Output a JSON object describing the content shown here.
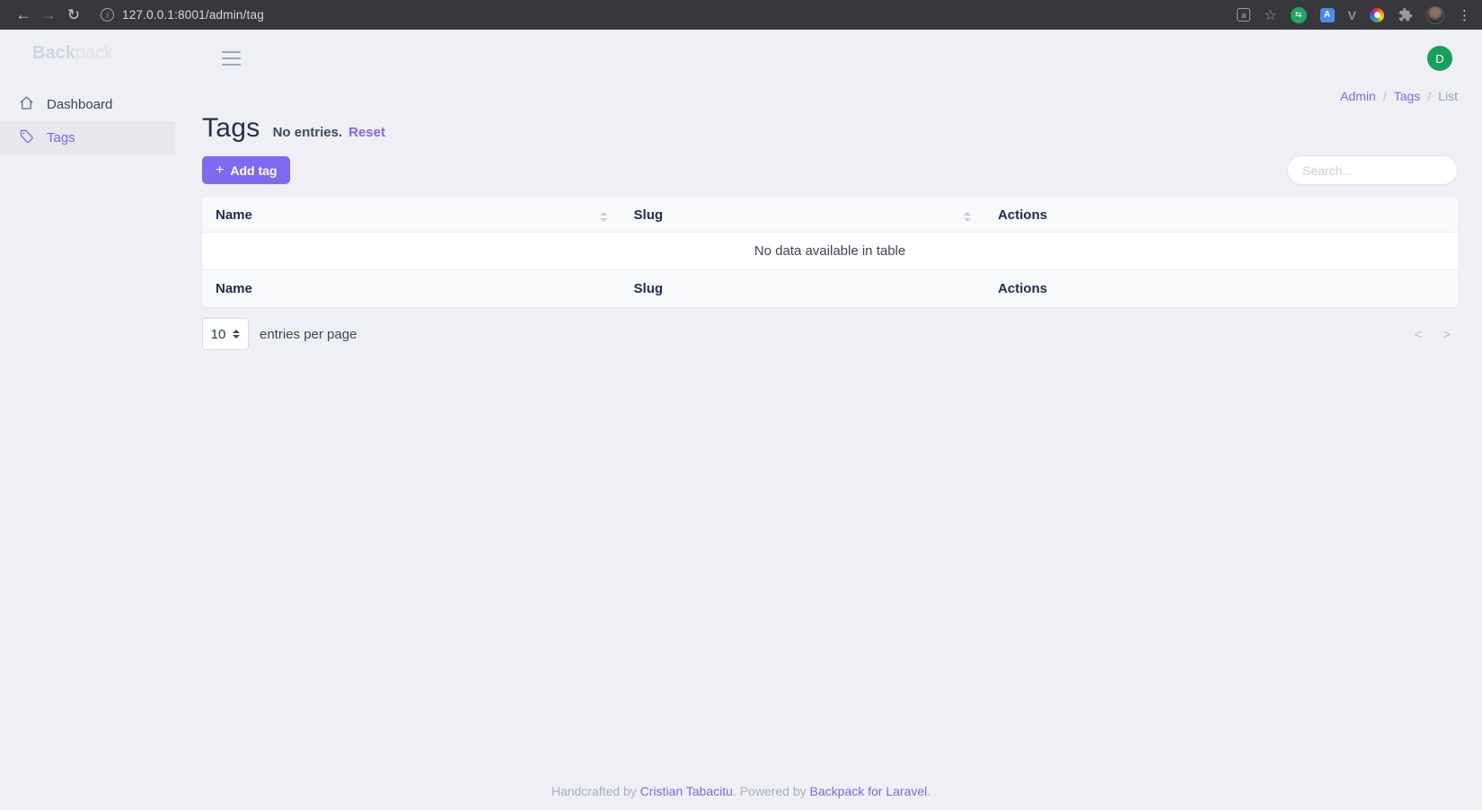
{
  "browser": {
    "url": "127.0.0.1:8001/admin/tag",
    "icons": {
      "back": "←",
      "forward": "→",
      "reload": "↻",
      "info": "i",
      "translate_page_letter": "a",
      "star": "☆",
      "hangouts_glyph": "⇆",
      "translate_ext_letter": "A",
      "vue_letter": "V",
      "menu_dots": "⋮"
    }
  },
  "sidebar": {
    "logo": {
      "bold": "Back",
      "light": "pack"
    },
    "items": [
      {
        "label": "Dashboard"
      },
      {
        "label": "Tags"
      }
    ]
  },
  "topbar": {
    "avatar_letter": "D"
  },
  "breadcrumb": {
    "items": [
      {
        "label": "Admin"
      },
      {
        "label": "Tags"
      },
      {
        "label": "List"
      }
    ],
    "separator": "/"
  },
  "page": {
    "title": "Tags",
    "subtitle": "No entries.",
    "reset_label": "Reset",
    "add_button_icon": "+",
    "add_button_label": "Add tag"
  },
  "search": {
    "placeholder": "Search..."
  },
  "table": {
    "columns": [
      "Name",
      "Slug",
      "Actions"
    ],
    "empty_text": "No data available in table"
  },
  "pagination": {
    "per_page_value": "10",
    "entries_label": "entries per page",
    "prev_icon": "<",
    "next_icon": ">"
  },
  "footer": {
    "prefix": "Handcrafted by ",
    "author_link": "Cristian Tabacitu",
    "middle": ". Powered by ",
    "product_link": "Backpack for Laravel",
    "suffix": "."
  },
  "colors": {
    "accent_purple": "#7c69ef",
    "button_purple": "#7d6af0",
    "avatar_green": "#18a05b",
    "heading_navy": "#25304b",
    "body_background": "#eef0f5",
    "browser_bar": "#37383c"
  }
}
